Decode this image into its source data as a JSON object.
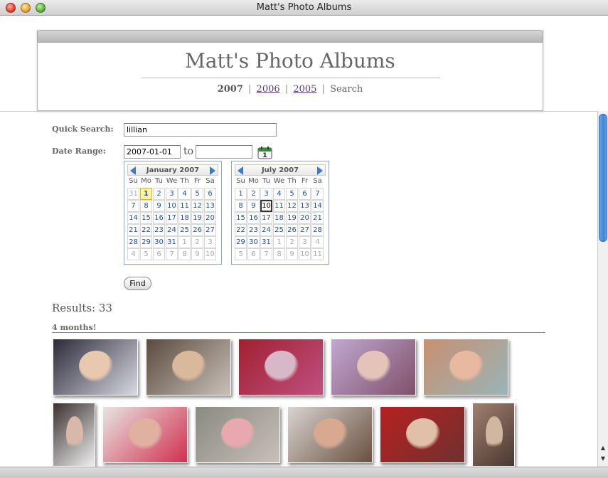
{
  "window": {
    "title": "Matt's Photo Albums"
  },
  "header": {
    "title": "Matt's Photo Albums",
    "nav": {
      "current": "2007",
      "link_2006": "2006",
      "link_2005": "2005",
      "search": "Search",
      "separator": "|"
    }
  },
  "form": {
    "quick_search_label": "Quick Search:",
    "quick_search_value": "lillian",
    "date_range_label": "Date Range:",
    "date_from": "2007-01-01",
    "to_label": "to",
    "date_to": "",
    "calendar_icon": "calendar-icon",
    "find_label": "Find"
  },
  "calendars": [
    {
      "month": "January 2007",
      "dow": [
        "Su",
        "Mo",
        "Tu",
        "We",
        "Th",
        "Fr",
        "Sa"
      ],
      "weeks": [
        [
          "31",
          "1",
          "2",
          "3",
          "4",
          "5",
          "6"
        ],
        [
          "7",
          "8",
          "9",
          "10",
          "11",
          "12",
          "13"
        ],
        [
          "14",
          "15",
          "16",
          "17",
          "18",
          "19",
          "20"
        ],
        [
          "21",
          "22",
          "23",
          "24",
          "25",
          "26",
          "27"
        ],
        [
          "28",
          "29",
          "30",
          "31",
          "1",
          "2",
          "3"
        ],
        [
          "4",
          "5",
          "6",
          "7",
          "8",
          "9",
          "10"
        ]
      ],
      "other_month": [
        [
          0,
          0
        ],
        [
          4,
          4
        ],
        [
          4,
          5
        ],
        [
          4,
          6
        ],
        [
          5,
          0
        ],
        [
          5,
          1
        ],
        [
          5,
          2
        ],
        [
          5,
          3
        ],
        [
          5,
          4
        ],
        [
          5,
          5
        ],
        [
          5,
          6
        ]
      ],
      "highlight": [
        0,
        1
      ],
      "highlight_kind": "today"
    },
    {
      "month": "July 2007",
      "dow": [
        "Su",
        "Mo",
        "Tu",
        "We",
        "Th",
        "Fr",
        "Sa"
      ],
      "weeks": [
        [
          "1",
          "2",
          "3",
          "4",
          "5",
          "6",
          "7"
        ],
        [
          "8",
          "9",
          "10",
          "11",
          "12",
          "13",
          "14"
        ],
        [
          "15",
          "16",
          "17",
          "18",
          "19",
          "20",
          "21"
        ],
        [
          "22",
          "23",
          "24",
          "25",
          "26",
          "27",
          "28"
        ],
        [
          "29",
          "30",
          "31",
          "1",
          "2",
          "3",
          "4"
        ],
        [
          "5",
          "6",
          "7",
          "8",
          "9",
          "10",
          "11"
        ]
      ],
      "other_month": [
        [
          4,
          3
        ],
        [
          4,
          4
        ],
        [
          4,
          5
        ],
        [
          4,
          6
        ],
        [
          5,
          0
        ],
        [
          5,
          1
        ],
        [
          5,
          2
        ],
        [
          5,
          3
        ],
        [
          5,
          4
        ],
        [
          5,
          5
        ],
        [
          5,
          6
        ]
      ],
      "highlight": [
        1,
        2
      ],
      "highlight_kind": "selected"
    }
  ],
  "results": {
    "text": "Results: 33"
  },
  "group": {
    "heading": "4 months!"
  },
  "colors": {
    "accent": "#3d7ac9",
    "link": "#5a3a6a",
    "muted_text": "#666666"
  },
  "photos": [
    {
      "name": "photo-baby-on-blanket",
      "tone": [
        "#2c2a3a",
        "#e8c9b0",
        "#d8d8e0"
      ]
    },
    {
      "name": "photo-father-holding-baby",
      "tone": [
        "#5b4a3e",
        "#d9b89c",
        "#c8c0b8"
      ]
    },
    {
      "name": "photo-baby-in-play-gym",
      "tone": [
        "#a02030",
        "#d8b8c8",
        "#c05080"
      ]
    },
    {
      "name": "photo-baby-and-man-lying",
      "tone": [
        "#c0a8d0",
        "#e4c4b8",
        "#80506a"
      ]
    },
    {
      "name": "photo-baby-in-bath",
      "tone": [
        "#c89070",
        "#e8b8a0",
        "#9ab4b8"
      ]
    },
    {
      "name": "photo-man-with-baby-partial",
      "tone": [
        "#3a3030",
        "#d8b8a8",
        "#f0f0f0"
      ]
    },
    {
      "name": "photo-baby-with-toy-ring",
      "tone": [
        "#e8e4e0",
        "#e0b0a0",
        "#d03050"
      ]
    },
    {
      "name": "photo-baby-on-mat",
      "tone": [
        "#8a8a80",
        "#e8a8b0",
        "#c8c0b8"
      ]
    },
    {
      "name": "photo-mother-holding-baby",
      "tone": [
        "#d8d4d0",
        "#d8a890",
        "#6a5040"
      ]
    },
    {
      "name": "photo-baby-in-bouncer",
      "tone": [
        "#b82020",
        "#e0c0a8",
        "#703030"
      ]
    },
    {
      "name": "photo-person-in-doorway",
      "tone": [
        "#a08070",
        "#d0b8a0",
        "#4a3830"
      ]
    }
  ]
}
